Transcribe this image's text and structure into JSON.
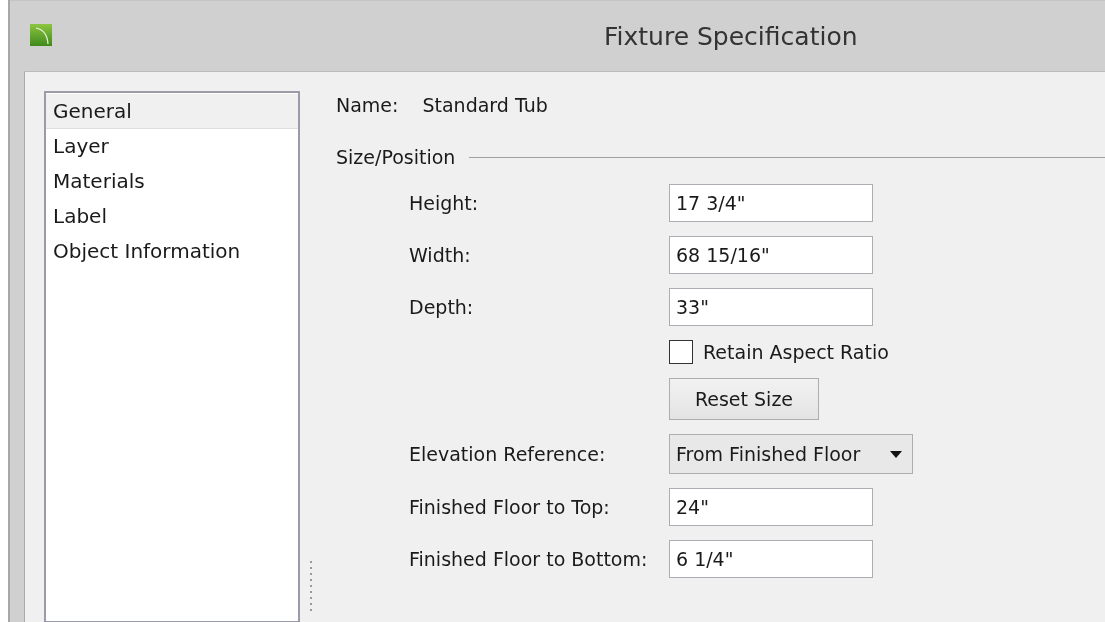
{
  "window": {
    "title": "Fixture Specification"
  },
  "sidebar": {
    "items": [
      {
        "label": "General",
        "selected": true
      },
      {
        "label": "Layer",
        "selected": false
      },
      {
        "label": "Materials",
        "selected": false
      },
      {
        "label": "Label",
        "selected": false
      },
      {
        "label": "Object Information",
        "selected": false
      }
    ]
  },
  "name": {
    "label": "Name:",
    "value": "Standard Tub"
  },
  "section": {
    "title": "Size/Position"
  },
  "rows": [
    {
      "kind": "field",
      "label": "Height:",
      "value": "17 3/4\""
    },
    {
      "kind": "field",
      "label": "Width:",
      "value": "68 15/16\""
    },
    {
      "kind": "field",
      "label": "Depth:",
      "value": "33\""
    },
    {
      "kind": "checkbox",
      "label": "Retain Aspect Ratio",
      "checked": false
    },
    {
      "kind": "button",
      "label": "Reset Size"
    },
    {
      "kind": "dropdown",
      "label": "Elevation Reference:",
      "value": "From Finished Floor"
    },
    {
      "kind": "field",
      "label": "Finished Floor to Top:",
      "value": "24\""
    },
    {
      "kind": "field",
      "label": "Finished Floor to Bottom:",
      "value": "6 1/4\""
    }
  ]
}
